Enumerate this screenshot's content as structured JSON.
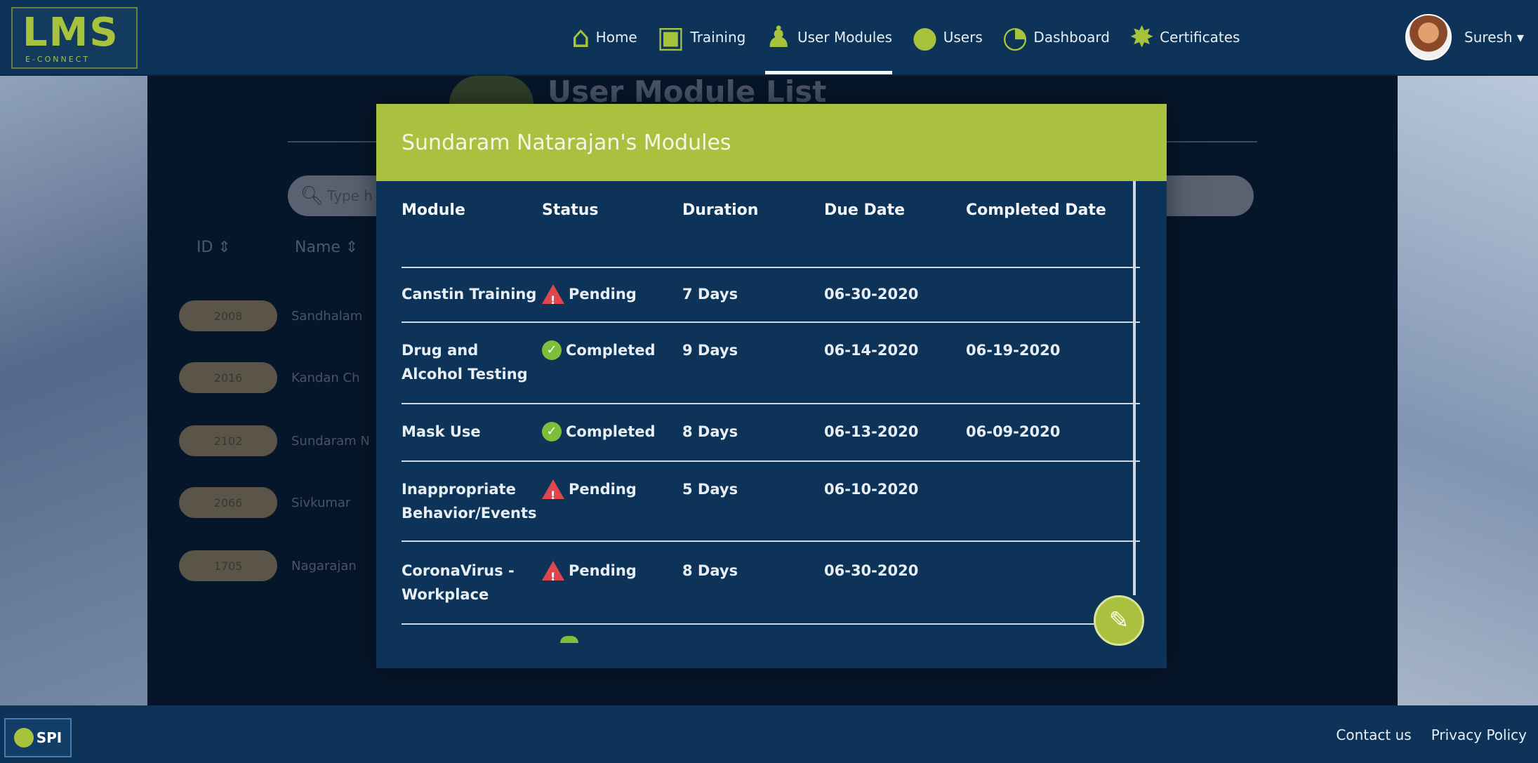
{
  "header": {
    "logo": {
      "main": "LMS",
      "sub": "E-CONNECT"
    },
    "nav": [
      {
        "label": "Home",
        "icon": "home-icon",
        "glyph": "⌂",
        "active": false
      },
      {
        "label": "Training",
        "icon": "training-icon",
        "glyph": "▣",
        "active": false
      },
      {
        "label": "User Modules",
        "icon": "user-modules-icon",
        "glyph": "♟",
        "active": true
      },
      {
        "label": "Users",
        "icon": "users-icon",
        "glyph": "●",
        "active": false
      },
      {
        "label": "Dashboard",
        "icon": "dashboard-icon",
        "glyph": "◔",
        "active": false
      },
      {
        "label": "Certificates",
        "icon": "certificates-icon",
        "glyph": "✸",
        "active": false
      }
    ],
    "user": {
      "name": "Suresh ▾"
    }
  },
  "background_page": {
    "title": "User Module List",
    "search_placeholder": "Type h",
    "columns": {
      "id": "ID ⇕",
      "name": "Name ⇕"
    },
    "rows": [
      {
        "id": "2008",
        "name": "Sandhalam"
      },
      {
        "id": "2016",
        "name": "Kandan Ch"
      },
      {
        "id": "2102",
        "name": "Sundaram N"
      },
      {
        "id": "2066",
        "name": "Sivkumar"
      },
      {
        "id": "1705",
        "name": "Nagarajan"
      }
    ]
  },
  "modal": {
    "title": "Sundaram Natarajan's Modules",
    "columns": [
      "Module",
      "Status",
      "Duration",
      "Due Date",
      "Completed Date"
    ],
    "rows": [
      {
        "module": "Canstin Training",
        "status": "Pending",
        "status_type": "pending",
        "duration": "7 Days",
        "due_date": "06-30-2020",
        "completed_date": ""
      },
      {
        "module": "Drug and Alcohol Testing",
        "status": "Completed",
        "status_type": "completed",
        "duration": "9 Days",
        "due_date": "06-14-2020",
        "completed_date": "06-19-2020"
      },
      {
        "module": "Mask Use",
        "status": "Completed",
        "status_type": "completed",
        "duration": "8 Days",
        "due_date": "06-13-2020",
        "completed_date": "06-09-2020"
      },
      {
        "module": "Inappropriate Behavior/Events",
        "status": "Pending",
        "status_type": "pending",
        "duration": "5 Days",
        "due_date": "06-10-2020",
        "completed_date": ""
      },
      {
        "module": "CoronaVirus - Workplace",
        "status": "Pending",
        "status_type": "pending",
        "duration": "8 Days",
        "due_date": "06-30-2020",
        "completed_date": ""
      }
    ],
    "edit_icon": "pencil-icon"
  },
  "footer": {
    "badge": "SPI",
    "links": [
      "Contact us",
      "Privacy Policy"
    ]
  },
  "colors": {
    "header_bg": "#0d3358",
    "accent_green": "#a9c13e",
    "pending_red": "#e0464e",
    "completed_green": "#7dbf3a"
  }
}
